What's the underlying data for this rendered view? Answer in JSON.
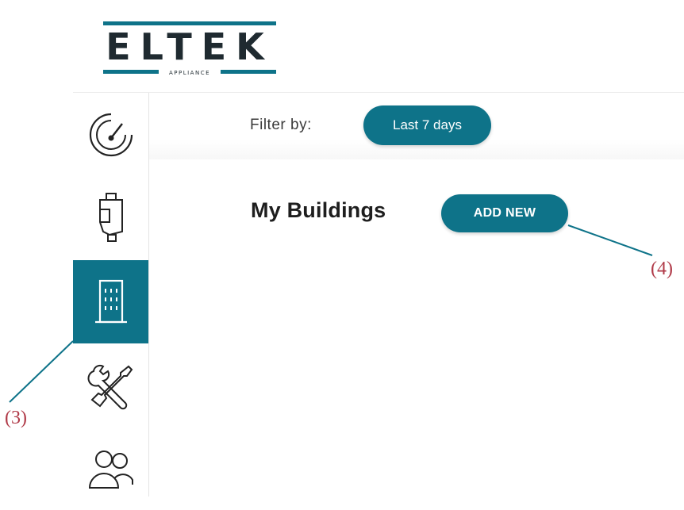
{
  "brand": {
    "logo_text": "ELTEK",
    "logo_subtext": "APPLIANCE",
    "accent_color": "#0e7389",
    "logo_color": "#1f2a30"
  },
  "sidebar": {
    "items": [
      {
        "icon": "speedometer-icon",
        "active": false
      },
      {
        "icon": "water-meter-icon",
        "active": false
      },
      {
        "icon": "building-icon",
        "active": true
      },
      {
        "icon": "tools-icon",
        "active": false
      },
      {
        "icon": "users-icon",
        "active": false
      }
    ]
  },
  "main": {
    "filter_label": "Filter by:",
    "filter_value": "Last 7 days",
    "section_title": "My Buildings",
    "add_button_label": "ADD NEW"
  },
  "annotations": {
    "callout_3": "(3)",
    "callout_4": "(4)",
    "callout_color": "#b03a48",
    "leader_color": "#0e7389"
  }
}
